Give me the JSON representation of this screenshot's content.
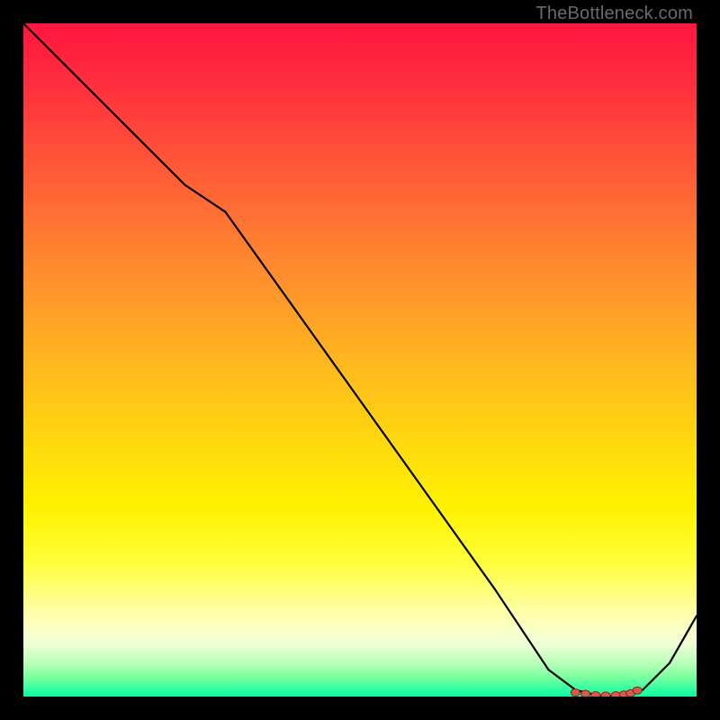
{
  "attribution": "TheBottleneck.com",
  "chart_data": {
    "type": "line",
    "title": "",
    "xlabel": "",
    "ylabel": "",
    "xlim": [
      0,
      100
    ],
    "ylim": [
      0,
      100
    ],
    "series": [
      {
        "name": "curve",
        "x": [
          0,
          8,
          16,
          24,
          30,
          40,
          50,
          60,
          70,
          78,
          82,
          86,
          90,
          92,
          96,
          100
        ],
        "y": [
          100,
          92,
          84,
          76,
          72,
          58,
          44,
          30,
          16,
          4,
          1,
          0,
          0.2,
          1,
          5,
          12
        ]
      }
    ],
    "markers": {
      "x": [
        82,
        83.5,
        85,
        86.5,
        88,
        89.2,
        90.2,
        91.2
      ],
      "y": [
        0.6,
        0.4,
        0.2,
        0.15,
        0.2,
        0.3,
        0.5,
        0.9
      ]
    },
    "grid": false,
    "legend": false
  },
  "colors": {
    "background_frame": "#000000",
    "curve": "#000000",
    "marker_fill": "#d75a4a",
    "marker_stroke": "#7a2d20"
  }
}
